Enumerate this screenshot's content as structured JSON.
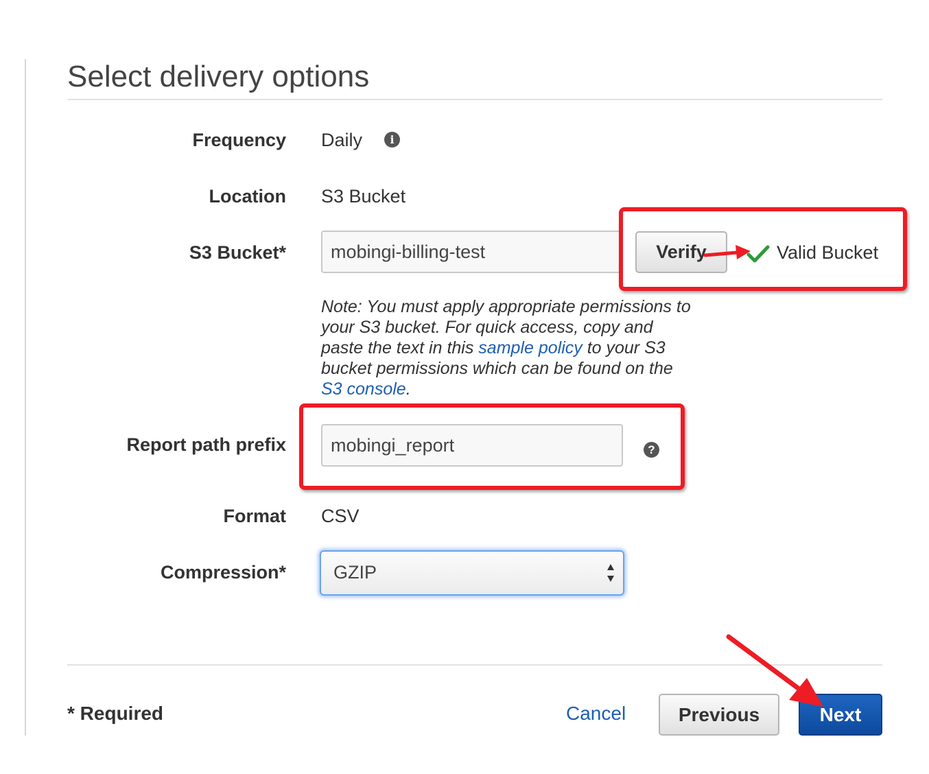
{
  "page": {
    "title": "Select delivery options"
  },
  "fields": {
    "frequency": {
      "label": "Frequency",
      "value": "Daily"
    },
    "location": {
      "label": "Location",
      "value": "S3 Bucket"
    },
    "s3_bucket": {
      "label": "S3 Bucket*",
      "value": "mobingi-billing-test",
      "verify_label": "Verify",
      "status": "Valid Bucket"
    },
    "note": {
      "part1": "Note: You must apply appropriate permissions to your S3 bucket. For quick access, copy and paste the text in this ",
      "link1": "sample policy",
      "part2": " to your S3 bucket permissions which can be found on the ",
      "link2": "S3 console",
      "part3": "."
    },
    "report_path_prefix": {
      "label": "Report path prefix",
      "value": "mobingi_report"
    },
    "format": {
      "label": "Format",
      "value": "CSV"
    },
    "compression": {
      "label": "Compression*",
      "value": "GZIP"
    }
  },
  "footer": {
    "required_text": "* Required",
    "cancel_label": "Cancel",
    "previous_label": "Previous",
    "next_label": "Next"
  },
  "icons": {
    "info": "info-icon",
    "help": "question-icon",
    "status": "checkmark-icon"
  },
  "colors": {
    "annotation_red": "#ee1c25",
    "link_blue": "#1f5fb0",
    "primary_button": "#0d4a9e",
    "valid_green": "#2e9a3a"
  }
}
